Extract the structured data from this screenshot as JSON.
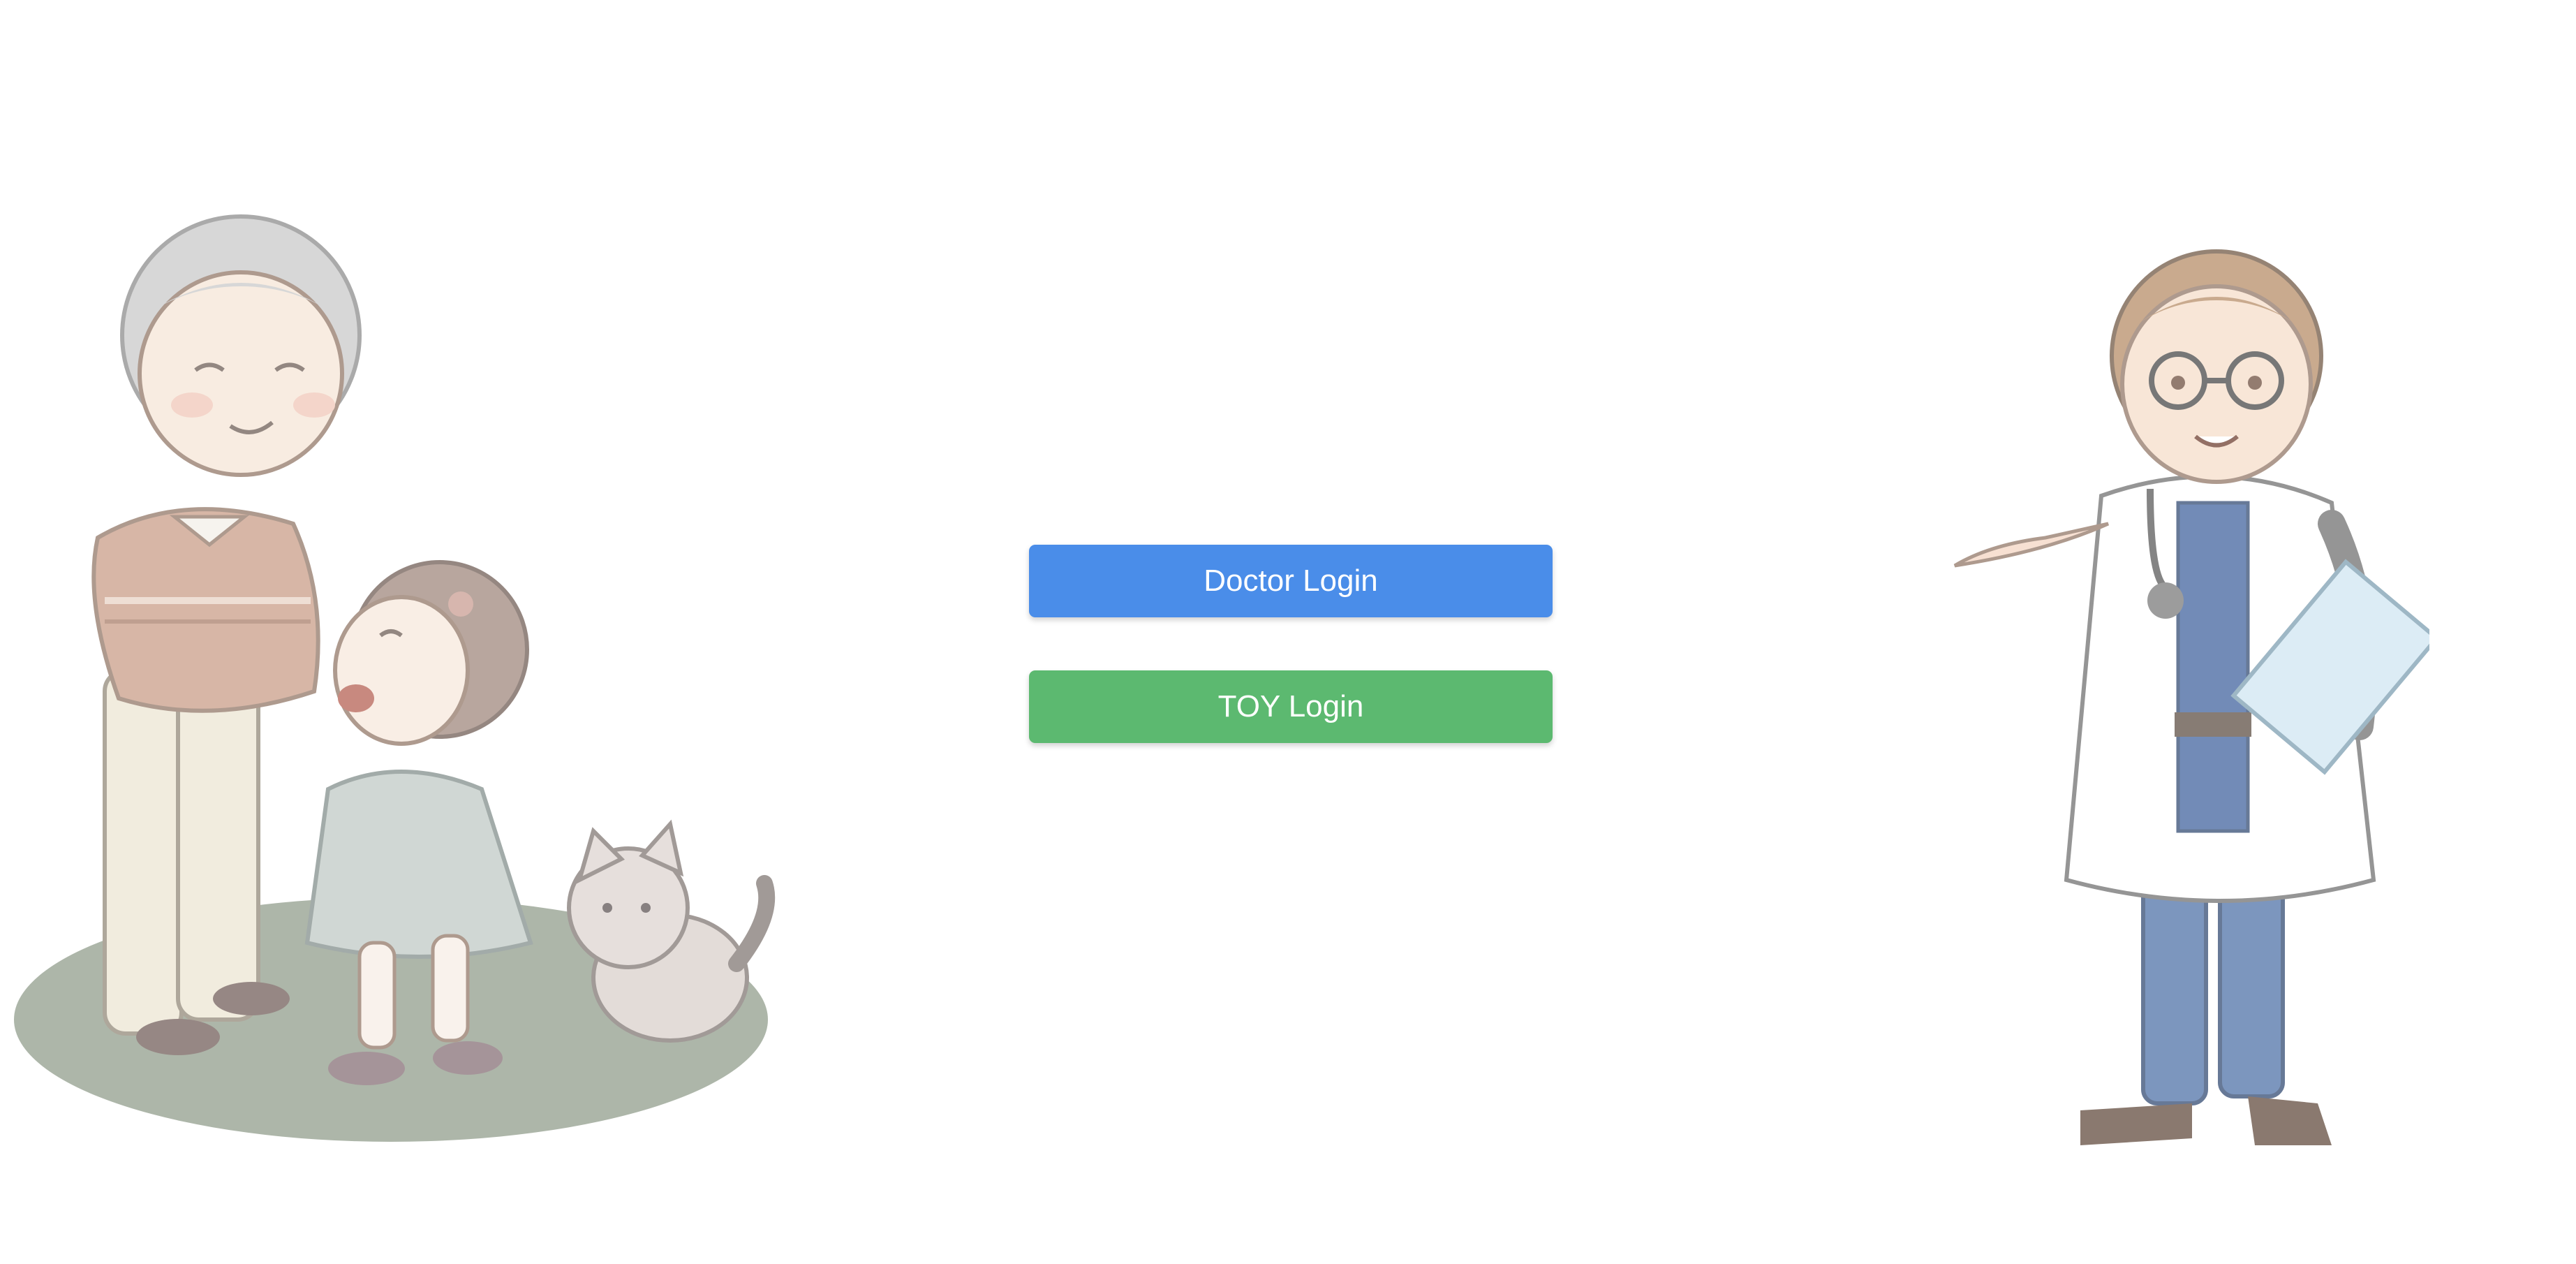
{
  "login": {
    "doctor_label": "Doctor Login",
    "toy_label": "TOY Login"
  },
  "colors": {
    "doctor_button": "#4a8de9",
    "toy_button": "#5cb970",
    "background": "#ffffff"
  },
  "illustrations": {
    "left": "grandmother-child-cat-illustration",
    "right": "doctor-illustration"
  }
}
